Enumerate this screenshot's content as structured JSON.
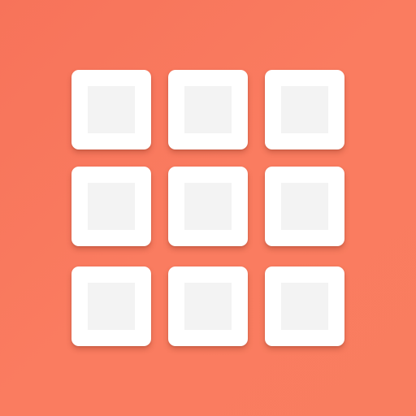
{
  "icon": {
    "name": "grid-app-icon",
    "background_color": "#f7735a",
    "tile_color": "#ffffff",
    "tile_inner_color": "#f3f3f3",
    "rows": 3,
    "columns": 3
  }
}
